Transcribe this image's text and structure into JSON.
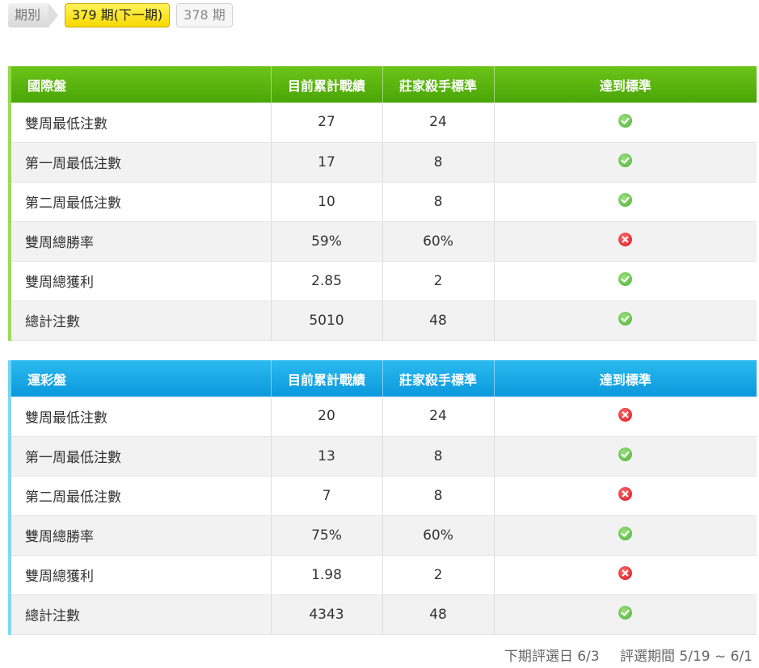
{
  "period_bar": {
    "label": "期別",
    "current": "379 期(下一期)",
    "previous": "378 期"
  },
  "tables": [
    {
      "headers": [
        "國際盤",
        "目前累計戰績",
        "莊家殺手標準",
        "達到標準"
      ],
      "rows": [
        {
          "label": "雙周最低注數",
          "current": "27",
          "standard": "24",
          "status": "check-icon"
        },
        {
          "label": "第一周最低注數",
          "current": "17",
          "standard": "8",
          "status": "check-icon"
        },
        {
          "label": "第二周最低注數",
          "current": "10",
          "standard": "8",
          "status": "check-icon"
        },
        {
          "label": "雙周總勝率",
          "current": "59%",
          "standard": "60%",
          "status": "cross-icon"
        },
        {
          "label": "雙周總獲利",
          "current": "2.85",
          "standard": "2",
          "status": "check-icon"
        },
        {
          "label": "總計注數",
          "current": "5010",
          "standard": "48",
          "status": "check-icon"
        }
      ]
    },
    {
      "headers": [
        "運彩盤",
        "目前累計戰績",
        "莊家殺手標準",
        "達到標準"
      ],
      "rows": [
        {
          "label": "雙周最低注數",
          "current": "20",
          "standard": "24",
          "status": "cross-icon"
        },
        {
          "label": "第一周最低注數",
          "current": "13",
          "standard": "8",
          "status": "check-icon"
        },
        {
          "label": "第二周最低注數",
          "current": "7",
          "standard": "8",
          "status": "cross-icon"
        },
        {
          "label": "雙周總勝率",
          "current": "75%",
          "standard": "60%",
          "status": "check-icon"
        },
        {
          "label": "雙周總獲利",
          "current": "1.98",
          "standard": "2",
          "status": "cross-icon"
        },
        {
          "label": "總計注數",
          "current": "4343",
          "standard": "48",
          "status": "check-icon"
        }
      ]
    }
  ],
  "footer": {
    "next_review": "下期評選日 6/3",
    "review_period": "評選期間 5/19 ~ 6/1"
  },
  "colors": {
    "table1_header": "#5cb511",
    "table2_header": "#1aa8e6",
    "check": "#4caf3a",
    "cross": "#d8141f",
    "active_period": "#f7d900"
  }
}
